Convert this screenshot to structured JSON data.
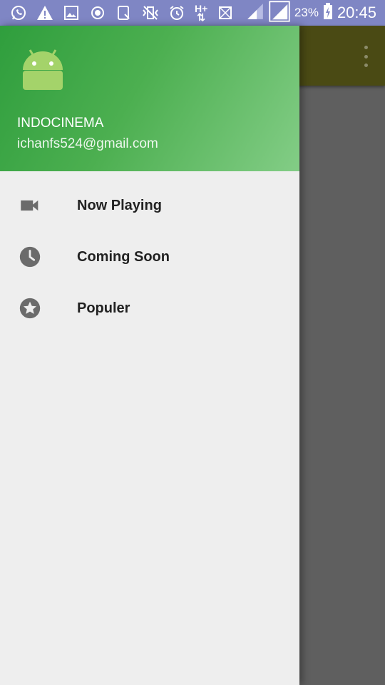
{
  "status_bar": {
    "battery_percent": "23%",
    "time": "20:45",
    "network_label": "H+"
  },
  "drawer": {
    "header": {
      "name": "INDOCINEMA",
      "email": "ichanfs524@gmail.com"
    },
    "items": [
      {
        "label": "Now Playing",
        "icon": "videocam-icon"
      },
      {
        "label": "Coming Soon",
        "icon": "clock-icon"
      },
      {
        "label": "Populer",
        "icon": "star-icon"
      }
    ]
  },
  "colors": {
    "status_bar": "#7f86c4",
    "header_start": "#2f9e3d",
    "header_end": "#83cd86",
    "drawer_bg": "#eeeeee",
    "icon": "#6b6b6b"
  }
}
